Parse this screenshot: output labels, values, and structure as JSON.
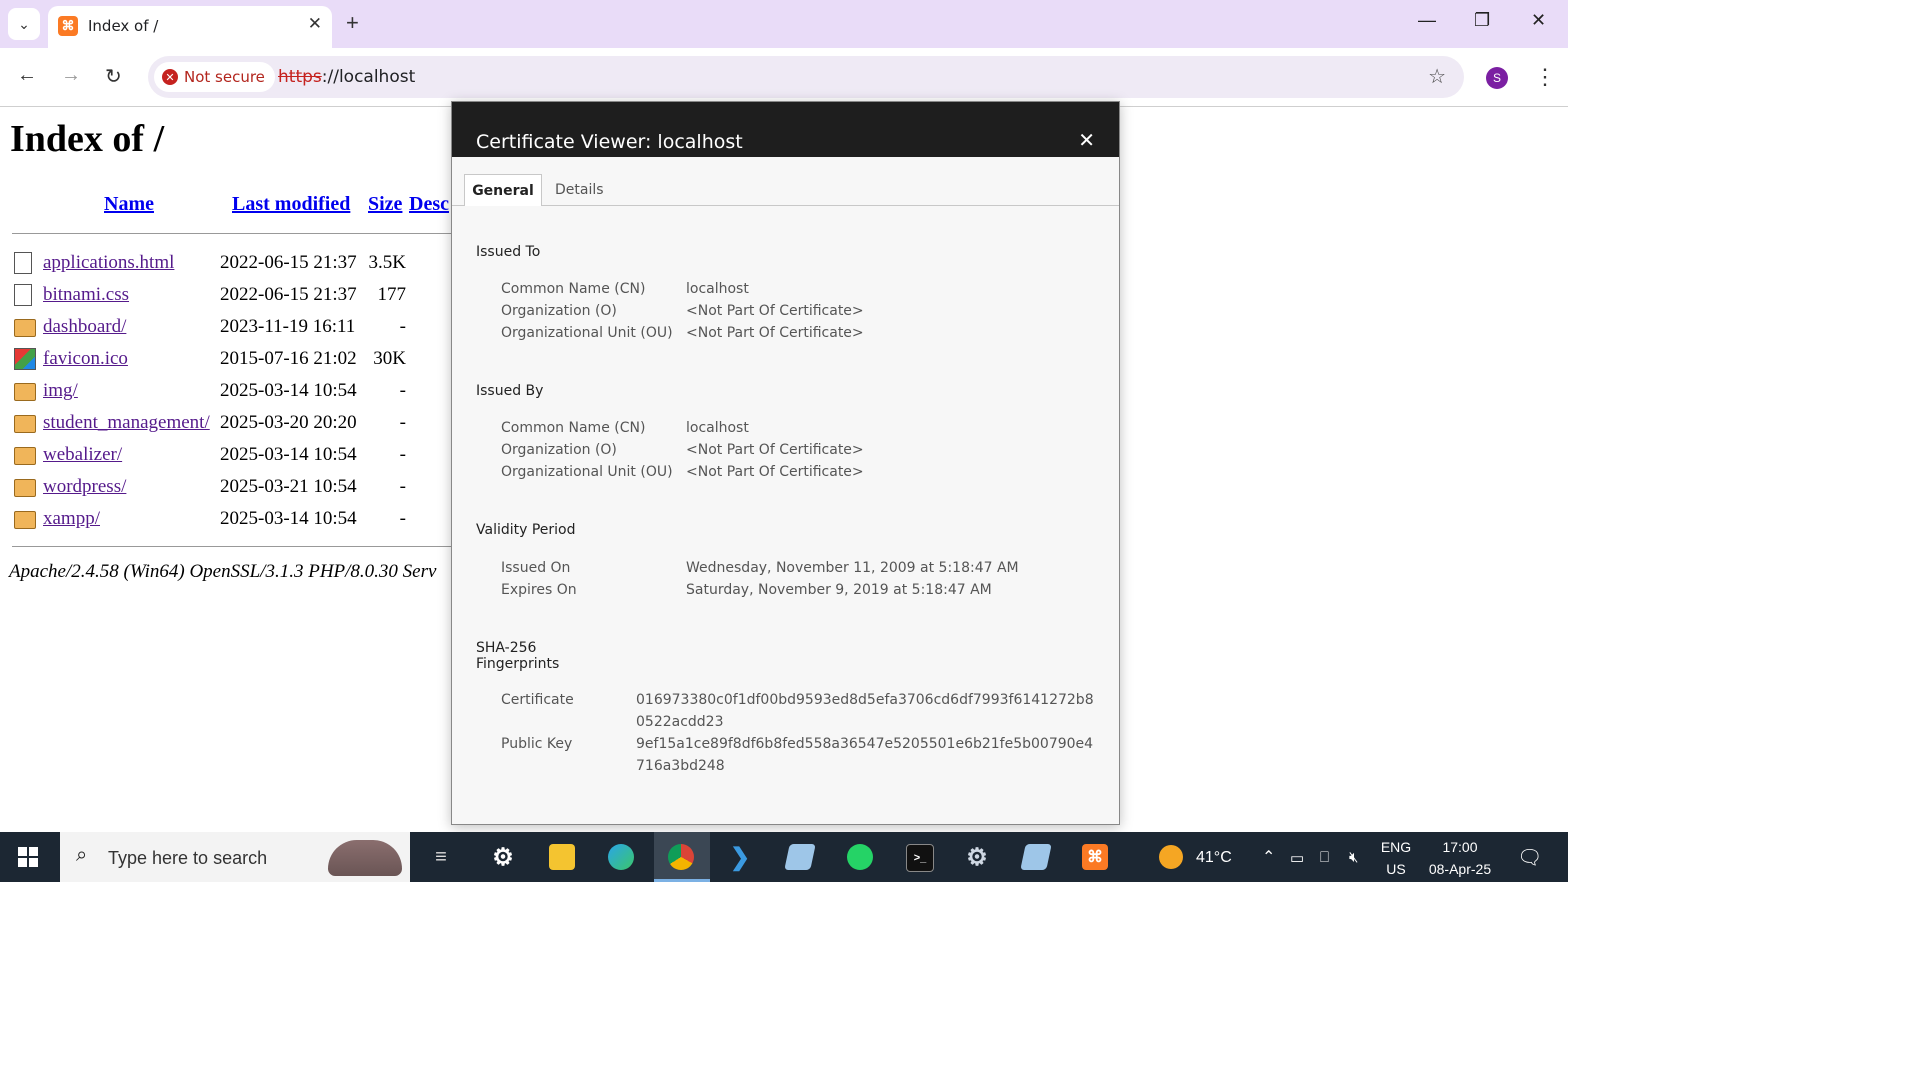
{
  "browser": {
    "tab_title": "Index of /",
    "url_scheme": "https",
    "url_rest": "://localhost",
    "not_secure": "Not secure",
    "profile_initial": "S"
  },
  "page": {
    "heading": "Index of /",
    "columns": [
      "Name",
      "Last modified",
      "Size",
      "Desc"
    ],
    "rows": [
      {
        "name": "applications.html",
        "date": "2022-06-15 21:37",
        "size": "3.5K",
        "icon": "document-icon"
      },
      {
        "name": "bitnami.css",
        "date": "2022-06-15 21:37",
        "size": "177",
        "icon": "document-icon"
      },
      {
        "name": "dashboard/",
        "date": "2023-11-19 16:11",
        "size": "-",
        "icon": "folder-icon"
      },
      {
        "name": "favicon.ico",
        "date": "2015-07-16 21:02",
        "size": "30K",
        "icon": "image-icon"
      },
      {
        "name": "img/",
        "date": "2025-03-14 10:54",
        "size": "-",
        "icon": "folder-icon"
      },
      {
        "name": "student_management/",
        "date": "2025-03-20 20:20",
        "size": "-",
        "icon": "folder-icon"
      },
      {
        "name": "webalizer/",
        "date": "2025-03-14 10:54",
        "size": "-",
        "icon": "folder-icon"
      },
      {
        "name": "wordpress/",
        "date": "2025-03-21 10:54",
        "size": "-",
        "icon": "folder-icon"
      },
      {
        "name": "xampp/",
        "date": "2025-03-14 10:54",
        "size": "-",
        "icon": "folder-icon"
      }
    ],
    "footer": "Apache/2.4.58 (Win64) OpenSSL/3.1.3 PHP/8.0.30 Serv"
  },
  "certificate": {
    "title": "Certificate Viewer: localhost",
    "tabs": [
      "General",
      "Details"
    ],
    "issued_to": {
      "heading": "Issued To",
      "cn_label": "Common Name (CN)",
      "cn": "localhost",
      "o_label": "Organization (O)",
      "o": "<Not Part Of Certificate>",
      "ou_label": "Organizational Unit (OU)",
      "ou": "<Not Part Of Certificate>"
    },
    "issued_by": {
      "heading": "Issued By",
      "cn_label": "Common Name (CN)",
      "cn": "localhost",
      "o_label": "Organization (O)",
      "o": "<Not Part Of Certificate>",
      "ou_label": "Organizational Unit (OU)",
      "ou": "<Not Part Of Certificate>"
    },
    "validity": {
      "heading": "Validity Period",
      "issued_label": "Issued On",
      "issued": "Wednesday, November 11, 2009 at 5:18:47 AM",
      "expires_label": "Expires On",
      "expires": "Saturday, November 9, 2019 at 5:18:47 AM"
    },
    "fingerprints": {
      "heading_line1": "SHA-256",
      "heading_line2": "Fingerprints",
      "cert_label": "Certificate",
      "cert": "016973380c0f1df00bd9593ed8d5efa3706cd6df7993f6141272b80522acdd23",
      "key_label": "Public Key",
      "key": "9ef15a1ce89f8df6b8fed558a36547e5205501e6b21fe5b00790e4716a3bd248"
    }
  },
  "taskbar": {
    "search_placeholder": "Type here to search",
    "temperature": "41°C",
    "lang1": "ENG",
    "lang2": "US",
    "time": "17:00",
    "date": "08-Apr-25"
  }
}
